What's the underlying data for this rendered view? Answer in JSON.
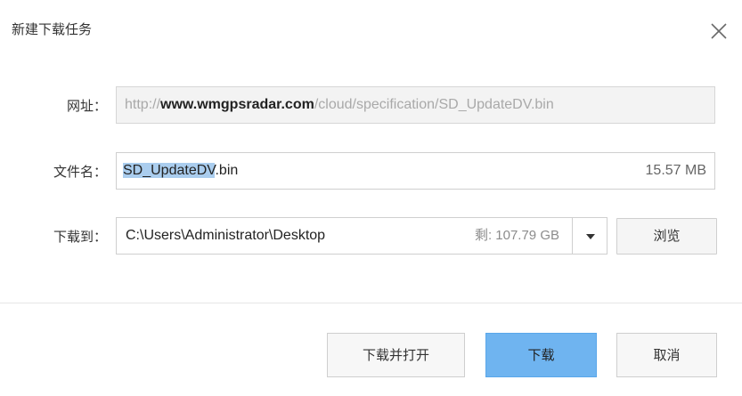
{
  "dialog": {
    "title": "新建下载任务",
    "close_icon": "close-icon"
  },
  "url": {
    "label": "网址：",
    "prefix": "http://",
    "domain": "www.wmgpsradar.com",
    "path": "/cloud/specification/SD_UpdateDV.bin"
  },
  "filename": {
    "label": "文件名：",
    "selected_part": "SD_UpdateDV",
    "extension": ".bin",
    "size": "15.57 MB"
  },
  "save_to": {
    "label": "下载到：",
    "path": "C:\\Users\\Administrator\\Desktop",
    "free_space": "剩: 107.79 GB",
    "dropdown_icon": "chevron-down-icon",
    "browse_label": "浏览"
  },
  "actions": {
    "download_open_label": "下载并打开",
    "download_label": "下载",
    "cancel_label": "取消"
  },
  "colors": {
    "primary_button": "#6fb4f0",
    "selection": "#aacdee"
  }
}
